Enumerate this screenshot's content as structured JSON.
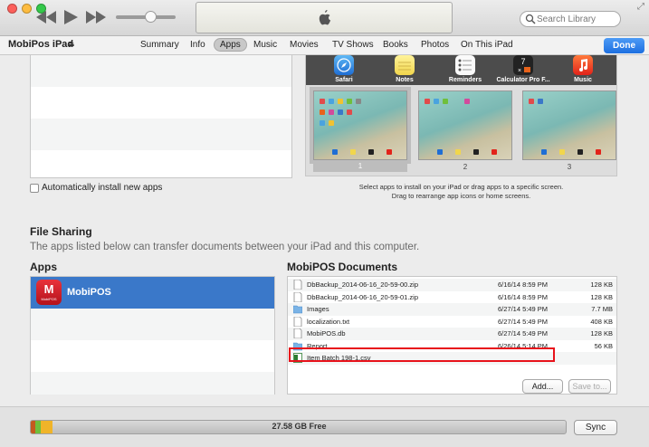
{
  "toolbar": {
    "search_placeholder": "Search Library"
  },
  "tabbar": {
    "device_name": "MobiPos iPad",
    "tabs": [
      "Summary",
      "Info",
      "Apps",
      "Music",
      "Movies",
      "TV Shows",
      "Books",
      "Photos",
      "On This iPad"
    ],
    "active_tab": "Apps",
    "done_label": "Done"
  },
  "apps_section": {
    "auto_install_label": "Automatically install new apps",
    "auto_install_checked": false,
    "dock_apps": [
      {
        "label": "Safari",
        "icon": "safari-icon",
        "badge": ""
      },
      {
        "label": "Notes",
        "icon": "notes-icon",
        "badge": ""
      },
      {
        "label": "Reminders",
        "icon": "reminders-icon",
        "badge": ""
      },
      {
        "label": "Calculator Pro F...",
        "icon": "calculator-icon",
        "badge": "7"
      },
      {
        "label": "Music",
        "icon": "music-icon",
        "badge": ""
      }
    ],
    "home_screens": [
      "1",
      "2",
      "3"
    ],
    "selected_screen": "1",
    "hint_line1": "Select apps to install on your iPad or drag apps to a specific screen.",
    "hint_line2": "Drag to rearrange app icons or home screens."
  },
  "file_sharing": {
    "title": "File Sharing",
    "description": "The apps listed below can transfer documents between your iPad and this computer.",
    "apps_header": "Apps",
    "apps": [
      {
        "name": "MobiPOS",
        "icon_text": "M",
        "icon_subtext": "MobiPOS"
      }
    ],
    "docs_header": "MobiPOS Documents",
    "documents": [
      {
        "name": "DbBackup_2014-06-16_20-59-00.zip",
        "date": "6/16/14 8:59 PM",
        "size": "128 KB",
        "type": "file-icon"
      },
      {
        "name": "DbBackup_2014-06-16_20-59-01.zip",
        "date": "6/16/14 8:59 PM",
        "size": "128 KB",
        "type": "file-icon"
      },
      {
        "name": "Images",
        "date": "6/27/14 5:49 PM",
        "size": "7.7 MB",
        "type": "folder-icon"
      },
      {
        "name": "localization.txt",
        "date": "6/27/14 5:49 PM",
        "size": "408 KB",
        "type": "file-icon"
      },
      {
        "name": "MobiPOS.db",
        "date": "6/27/14 5:49 PM",
        "size": "128 KB",
        "type": "file-icon"
      },
      {
        "name": "Report",
        "date": "6/26/14 5:14 PM",
        "size": "56 KB",
        "type": "folder-icon"
      },
      {
        "name": "Item Batch 198-1.csv",
        "date": "",
        "size": "",
        "type": "spreadsheet-icon"
      }
    ],
    "add_label": "Add...",
    "save_label": "Save to..."
  },
  "capacity": {
    "free_label": "27.58 GB Free",
    "sync_label": "Sync",
    "colors": {
      "audio": "#e2742b",
      "apps": "#6fbf3c",
      "other": "#f0b429",
      "free": "#c4c4c4"
    }
  }
}
